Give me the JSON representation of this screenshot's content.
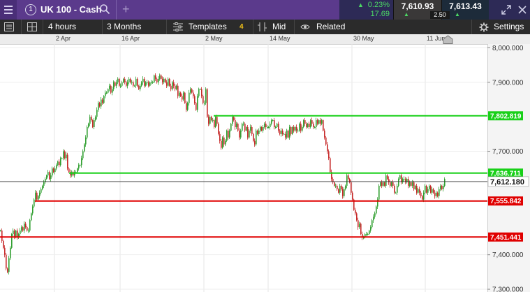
{
  "header": {
    "menu_icon": "hamburger-icon",
    "instrument_number": "1",
    "instrument_name": "UK 100 - Cash",
    "change_percent": "0.23%",
    "change_points": "17.69",
    "bid": "7,610.93",
    "ask": "7,613.43",
    "spread": "2.50",
    "accent_color": "#5b3a8c",
    "up_color": "#4cd964"
  },
  "toolbar": {
    "interval": "4 hours",
    "period": "3 Months",
    "templates_label": "Templates",
    "templates_count": "4",
    "price_type": "Mid",
    "related_label": "Related",
    "settings_label": "Settings"
  },
  "date_axis": [
    "2 Apr",
    "16 Apr",
    "2 May",
    "14 May",
    "30 May",
    "11 Jun"
  ],
  "chart_data": {
    "type": "candlestick",
    "y_ticks": [
      "8,000.000",
      "7,900.000",
      "7,700.000",
      "7,400.000",
      "7,300.000"
    ],
    "ylim": [
      7292,
      8011
    ],
    "current_price": "7,612.180",
    "close_path": [
      [
        0,
        7470
      ],
      [
        2,
        7440
      ],
      [
        4,
        7420
      ],
      [
        6,
        7400
      ],
      [
        8,
        7360
      ],
      [
        10,
        7350
      ],
      [
        12,
        7390
      ],
      [
        14,
        7420
      ],
      [
        16,
        7460
      ],
      [
        18,
        7470
      ],
      [
        20,
        7450
      ],
      [
        22,
        7470
      ],
      [
        24,
        7450
      ],
      [
        26,
        7460
      ],
      [
        28,
        7470
      ],
      [
        30,
        7480
      ],
      [
        32,
        7470
      ],
      [
        34,
        7490
      ],
      [
        36,
        7480
      ],
      [
        38,
        7470
      ],
      [
        40,
        7470
      ],
      [
        42,
        7500
      ],
      [
        44,
        7520
      ],
      [
        46,
        7540
      ],
      [
        48,
        7560
      ],
      [
        50,
        7580
      ],
      [
        52,
        7560
      ],
      [
        54,
        7570
      ],
      [
        56,
        7580
      ],
      [
        58,
        7590
      ],
      [
        60,
        7600
      ],
      [
        62,
        7610
      ],
      [
        64,
        7620
      ],
      [
        66,
        7630
      ],
      [
        68,
        7640
      ],
      [
        70,
        7620
      ],
      [
        72,
        7630
      ],
      [
        74,
        7650
      ],
      [
        76,
        7640
      ],
      [
        78,
        7650
      ],
      [
        80,
        7660
      ],
      [
        82,
        7670
      ],
      [
        84,
        7660
      ],
      [
        86,
        7680
      ],
      [
        88,
        7680
      ],
      [
        90,
        7700
      ],
      [
        92,
        7680
      ],
      [
        94,
        7690
      ],
      [
        96,
        7650
      ],
      [
        98,
        7640
      ],
      [
        100,
        7630
      ],
      [
        102,
        7640
      ],
      [
        104,
        7630
      ],
      [
        106,
        7640
      ],
      [
        108,
        7640
      ],
      [
        110,
        7650
      ],
      [
        112,
        7660
      ],
      [
        114,
        7660
      ],
      [
        116,
        7680
      ],
      [
        118,
        7700
      ],
      [
        120,
        7720
      ],
      [
        122,
        7740
      ],
      [
        124,
        7770
      ],
      [
        126,
        7780
      ],
      [
        128,
        7800
      ],
      [
        130,
        7790
      ],
      [
        132,
        7770
      ],
      [
        134,
        7790
      ],
      [
        136,
        7800
      ],
      [
        138,
        7820
      ],
      [
        140,
        7840
      ],
      [
        142,
        7830
      ],
      [
        144,
        7850
      ],
      [
        146,
        7840
      ],
      [
        148,
        7860
      ],
      [
        150,
        7870
      ],
      [
        152,
        7870
      ],
      [
        154,
        7880
      ],
      [
        156,
        7890
      ],
      [
        158,
        7870
      ],
      [
        160,
        7880
      ],
      [
        162,
        7900
      ],
      [
        164,
        7890
      ],
      [
        166,
        7900
      ],
      [
        168,
        7910
      ],
      [
        170,
        7890
      ],
      [
        172,
        7890
      ],
      [
        174,
        7900
      ],
      [
        176,
        7910
      ],
      [
        178,
        7900
      ],
      [
        180,
        7890
      ],
      [
        182,
        7900
      ],
      [
        184,
        7910
      ],
      [
        186,
        7900
      ],
      [
        188,
        7900
      ],
      [
        190,
        7890
      ],
      [
        192,
        7890
      ],
      [
        194,
        7910
      ],
      [
        196,
        7890
      ],
      [
        198,
        7880
      ],
      [
        200,
        7890
      ],
      [
        202,
        7900
      ],
      [
        204,
        7910
      ],
      [
        206,
        7890
      ],
      [
        208,
        7900
      ],
      [
        210,
        7900
      ],
      [
        212,
        7890
      ],
      [
        214,
        7900
      ],
      [
        216,
        7900
      ],
      [
        218,
        7900
      ],
      [
        220,
        7920
      ],
      [
        222,
        7910
      ],
      [
        224,
        7900
      ],
      [
        226,
        7910
      ],
      [
        228,
        7920
      ],
      [
        230,
        7910
      ],
      [
        232,
        7900
      ],
      [
        234,
        7910
      ],
      [
        236,
        7900
      ],
      [
        238,
        7890
      ],
      [
        240,
        7910
      ],
      [
        242,
        7890
      ],
      [
        244,
        7880
      ],
      [
        246,
        7900
      ],
      [
        248,
        7890
      ],
      [
        250,
        7880
      ],
      [
        252,
        7890
      ],
      [
        254,
        7860
      ],
      [
        256,
        7870
      ],
      [
        258,
        7860
      ],
      [
        260,
        7850
      ],
      [
        262,
        7870
      ],
      [
        264,
        7840
      ],
      [
        266,
        7820
      ],
      [
        268,
        7840
      ],
      [
        270,
        7870
      ],
      [
        272,
        7880
      ],
      [
        274,
        7870
      ],
      [
        276,
        7860
      ],
      [
        278,
        7840
      ],
      [
        280,
        7820
      ],
      [
        282,
        7860
      ],
      [
        284,
        7880
      ],
      [
        286,
        7880
      ],
      [
        288,
        7860
      ],
      [
        290,
        7840
      ],
      [
        292,
        7840
      ],
      [
        294,
        7880
      ],
      [
        296,
        7800
      ],
      [
        298,
        7780
      ],
      [
        300,
        7800
      ],
      [
        302,
        7790
      ],
      [
        304,
        7790
      ],
      [
        306,
        7770
      ],
      [
        308,
        7800
      ],
      [
        310,
        7780
      ],
      [
        312,
        7750
      ],
      [
        314,
        7730
      ],
      [
        316,
        7710
      ],
      [
        318,
        7740
      ],
      [
        320,
        7720
      ],
      [
        322,
        7730
      ],
      [
        324,
        7760
      ],
      [
        326,
        7740
      ],
      [
        328,
        7760
      ],
      [
        330,
        7780
      ],
      [
        332,
        7800
      ],
      [
        334,
        7790
      ],
      [
        336,
        7770
      ],
      [
        338,
        7780
      ],
      [
        340,
        7760
      ],
      [
        342,
        7740
      ],
      [
        344,
        7760
      ],
      [
        346,
        7780
      ],
      [
        348,
        7780
      ],
      [
        350,
        7760
      ],
      [
        352,
        7770
      ],
      [
        354,
        7740
      ],
      [
        356,
        7760
      ],
      [
        358,
        7770
      ],
      [
        360,
        7750
      ],
      [
        362,
        7730
      ],
      [
        364,
        7720
      ],
      [
        366,
        7760
      ],
      [
        368,
        7750
      ],
      [
        370,
        7760
      ],
      [
        372,
        7770
      ],
      [
        374,
        7760
      ],
      [
        376,
        7770
      ],
      [
        378,
        7780
      ],
      [
        380,
        7770
      ],
      [
        382,
        7770
      ],
      [
        384,
        7770
      ],
      [
        386,
        7780
      ],
      [
        388,
        7790
      ],
      [
        390,
        7790
      ],
      [
        392,
        7770
      ],
      [
        394,
        7770
      ],
      [
        396,
        7780
      ],
      [
        398,
        7760
      ],
      [
        400,
        7750
      ],
      [
        402,
        7760
      ],
      [
        404,
        7750
      ],
      [
        406,
        7750
      ],
      [
        408,
        7740
      ],
      [
        410,
        7760
      ],
      [
        412,
        7740
      ],
      [
        414,
        7770
      ],
      [
        416,
        7750
      ],
      [
        418,
        7770
      ],
      [
        420,
        7760
      ],
      [
        422,
        7770
      ],
      [
        424,
        7760
      ],
      [
        426,
        7760
      ],
      [
        428,
        7780
      ],
      [
        430,
        7760
      ],
      [
        432,
        7770
      ],
      [
        434,
        7790
      ],
      [
        436,
        7780
      ],
      [
        438,
        7770
      ],
      [
        440,
        7780
      ],
      [
        442,
        7770
      ],
      [
        444,
        7790
      ],
      [
        446,
        7780
      ],
      [
        448,
        7770
      ],
      [
        450,
        7770
      ],
      [
        452,
        7790
      ],
      [
        454,
        7780
      ],
      [
        456,
        7790
      ],
      [
        458,
        7780
      ],
      [
        460,
        7790
      ],
      [
        462,
        7760
      ],
      [
        464,
        7740
      ],
      [
        466,
        7720
      ],
      [
        468,
        7700
      ],
      [
        470,
        7680
      ],
      [
        472,
        7640
      ],
      [
        474,
        7620
      ],
      [
        476,
        7610
      ],
      [
        478,
        7600
      ],
      [
        480,
        7600
      ],
      [
        482,
        7590
      ],
      [
        484,
        7580
      ],
      [
        486,
        7600
      ],
      [
        488,
        7590
      ],
      [
        490,
        7570
      ],
      [
        492,
        7590
      ],
      [
        494,
        7600
      ],
      [
        496,
        7630
      ],
      [
        498,
        7620
      ],
      [
        500,
        7610
      ],
      [
        502,
        7580
      ],
      [
        504,
        7560
      ],
      [
        506,
        7530
      ],
      [
        508,
        7520
      ],
      [
        510,
        7500
      ],
      [
        512,
        7480
      ],
      [
        514,
        7490
      ],
      [
        516,
        7460
      ],
      [
        518,
        7450
      ],
      [
        520,
        7450
      ],
      [
        522,
        7460
      ],
      [
        524,
        7460
      ],
      [
        526,
        7460
      ],
      [
        528,
        7470
      ],
      [
        530,
        7480
      ],
      [
        532,
        7500
      ],
      [
        534,
        7510
      ],
      [
        536,
        7520
      ],
      [
        538,
        7540
      ],
      [
        540,
        7560
      ],
      [
        542,
        7600
      ],
      [
        544,
        7610
      ],
      [
        546,
        7600
      ],
      [
        548,
        7610
      ],
      [
        550,
        7600
      ],
      [
        552,
        7630
      ],
      [
        554,
        7620
      ],
      [
        556,
        7610
      ],
      [
        558,
        7600
      ],
      [
        560,
        7610
      ],
      [
        562,
        7600
      ],
      [
        564,
        7580
      ],
      [
        566,
        7580
      ],
      [
        568,
        7600
      ],
      [
        570,
        7620
      ],
      [
        572,
        7630
      ],
      [
        574,
        7610
      ],
      [
        576,
        7620
      ],
      [
        578,
        7620
      ],
      [
        580,
        7610
      ],
      [
        582,
        7620
      ],
      [
        584,
        7600
      ],
      [
        586,
        7610
      ],
      [
        588,
        7600
      ],
      [
        590,
        7610
      ],
      [
        592,
        7590
      ],
      [
        594,
        7600
      ],
      [
        596,
        7580
      ],
      [
        598,
        7590
      ],
      [
        600,
        7580
      ],
      [
        602,
        7570
      ],
      [
        604,
        7560
      ],
      [
        606,
        7580
      ],
      [
        608,
        7600
      ],
      [
        610,
        7580
      ],
      [
        612,
        7590
      ],
      [
        614,
        7600
      ],
      [
        616,
        7580
      ],
      [
        618,
        7590
      ],
      [
        620,
        7580
      ],
      [
        622,
        7570
      ],
      [
        624,
        7580
      ],
      [
        626,
        7570
      ],
      [
        628,
        7590
      ],
      [
        630,
        7600
      ],
      [
        632,
        7590
      ],
      [
        634,
        7600
      ],
      [
        636,
        7620
      ]
    ]
  },
  "levels": [
    {
      "value": "7,802.819",
      "kind": "resistance",
      "color": "#19d019",
      "x_start": 306
    },
    {
      "value": "7,636.711",
      "kind": "resistance",
      "color": "#19d019",
      "x_start": 99
    },
    {
      "value": "7,555.842",
      "kind": "support",
      "color": "#e00000",
      "x_start": 50
    },
    {
      "value": "7,451.441",
      "kind": "support",
      "color": "#e00000",
      "x_start": 0
    }
  ]
}
